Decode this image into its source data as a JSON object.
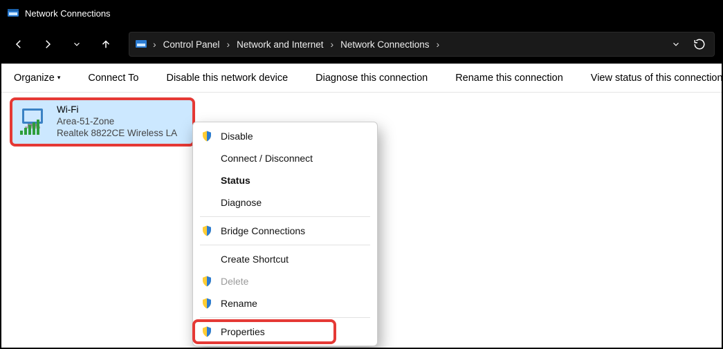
{
  "window": {
    "title": "Network Connections"
  },
  "breadcrumbs": {
    "items": [
      "Control Panel",
      "Network and Internet",
      "Network Connections"
    ]
  },
  "toolbar": {
    "organize": "Organize",
    "connect_to": "Connect To",
    "disable": "Disable this network device",
    "diagnose": "Diagnose this connection",
    "rename": "Rename this connection",
    "view_status": "View status of this connection"
  },
  "adapter": {
    "name": "Wi-Fi",
    "network": "Area-51-Zone",
    "device": "Realtek 8822CE Wireless LA"
  },
  "contextMenu": {
    "items": [
      {
        "label": "Disable",
        "shield": true,
        "disabled": false,
        "bold": false
      },
      {
        "label": "Connect / Disconnect",
        "shield": false,
        "disabled": false,
        "bold": false
      },
      {
        "label": "Status",
        "shield": false,
        "disabled": false,
        "bold": true
      },
      {
        "label": "Diagnose",
        "shield": false,
        "disabled": false,
        "bold": false
      },
      {
        "sep": true
      },
      {
        "label": "Bridge Connections",
        "shield": true,
        "disabled": false,
        "bold": false
      },
      {
        "sep": true
      },
      {
        "label": "Create Shortcut",
        "shield": false,
        "disabled": false,
        "bold": false
      },
      {
        "label": "Delete",
        "shield": true,
        "disabled": true,
        "bold": false
      },
      {
        "label": "Rename",
        "shield": true,
        "disabled": false,
        "bold": false
      },
      {
        "sep": true
      },
      {
        "label": "Properties",
        "shield": true,
        "disabled": false,
        "bold": false,
        "highlight": true
      }
    ]
  }
}
